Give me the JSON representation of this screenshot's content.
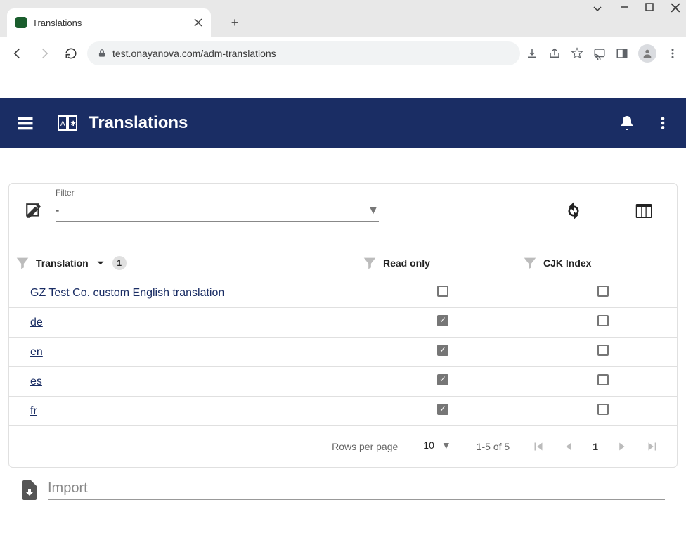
{
  "browser": {
    "tab_title": "Translations",
    "url": "test.onayanova.com/adm-translations"
  },
  "app_bar": {
    "title": "Translations"
  },
  "filter": {
    "label": "Filter",
    "value": "-"
  },
  "table": {
    "headers": {
      "translation": "Translation",
      "translation_sort_count": "1",
      "read_only": "Read only",
      "cjk_index": "CJK Index"
    },
    "rows": [
      {
        "name": "GZ Test Co. custom English translation",
        "read_only": false,
        "cjk": false
      },
      {
        "name": "de",
        "read_only": true,
        "cjk": false
      },
      {
        "name": "en",
        "read_only": true,
        "cjk": false
      },
      {
        "name": "es",
        "read_only": true,
        "cjk": false
      },
      {
        "name": "fr",
        "read_only": true,
        "cjk": false
      }
    ]
  },
  "pagination": {
    "rows_per_page_label": "Rows per page",
    "rows_per_page_value": "10",
    "range": "1-5 of 5",
    "current_page": "1"
  },
  "import": {
    "label": "Import"
  }
}
